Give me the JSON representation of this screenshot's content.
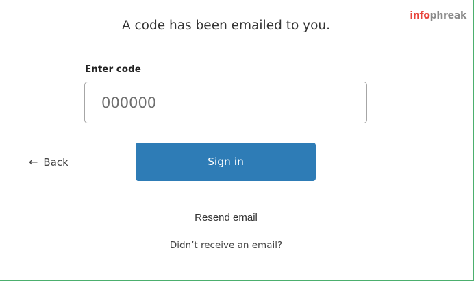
{
  "brand": {
    "logo_part1": "info",
    "logo_part2": "phreak",
    "logo_primary_color": "#e8433a",
    "logo_secondary_color": "#8a8a8a"
  },
  "heading": "A code has been emailed to you.",
  "code_field": {
    "label": "Enter code",
    "placeholder": "000000",
    "value": ""
  },
  "back": {
    "icon": "left-arrow-icon",
    "arrow_glyph": "←",
    "label": "Back"
  },
  "signin_button": {
    "label": "Sign in",
    "color": "#2e7cb6"
  },
  "resend_link": "Resend email",
  "no_email_link": "Didn’t receive an email?",
  "frame_accent_color": "#4caf6e"
}
